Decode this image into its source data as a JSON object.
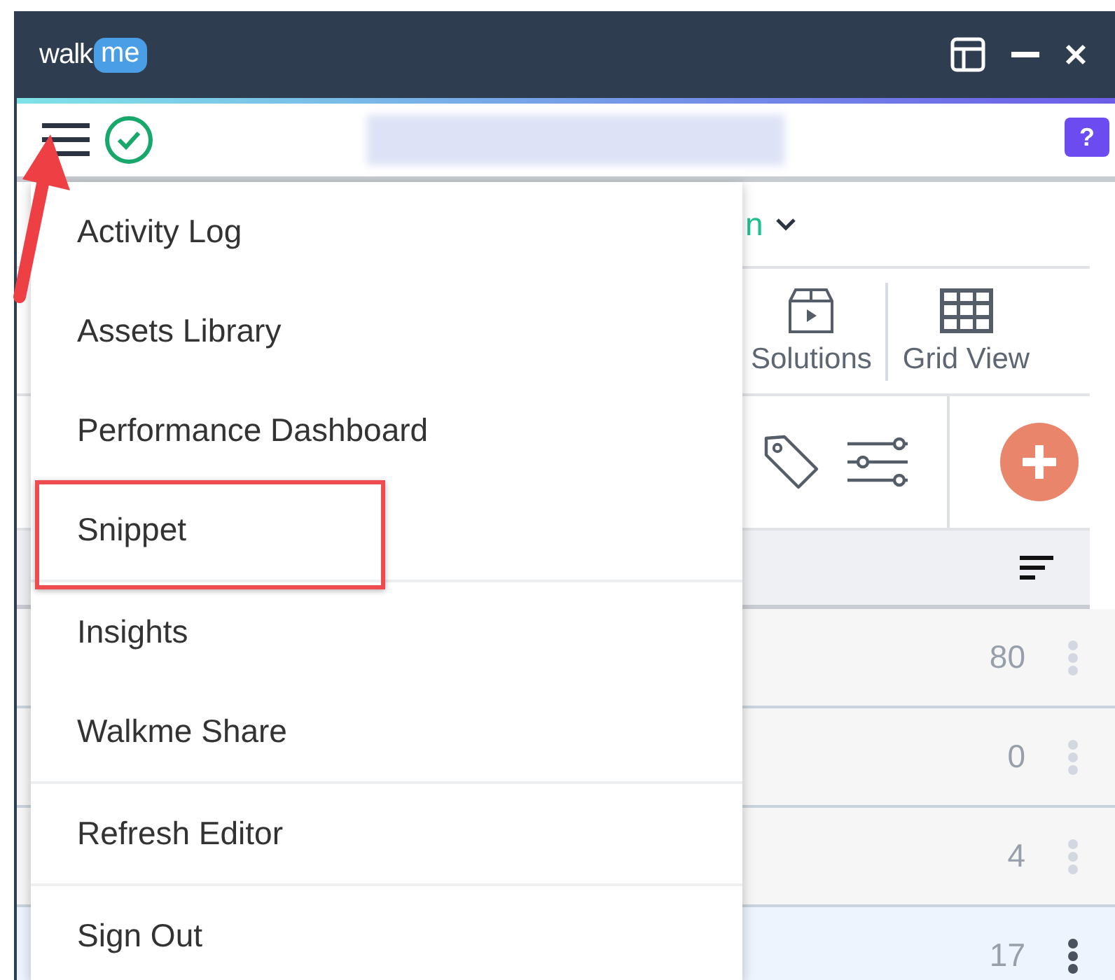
{
  "window": {
    "logo": {
      "word": "walk",
      "bubble": "me"
    }
  },
  "toolbar": {
    "help_label": "?"
  },
  "project_selector": {
    "label": "n"
  },
  "views": [
    {
      "label": "Solutions",
      "kind": "solutions"
    },
    {
      "label": "Grid View",
      "kind": "grid"
    }
  ],
  "table": {
    "rows": [
      {
        "count": "80",
        "selected": false
      },
      {
        "count": "0",
        "selected": false
      },
      {
        "count": "4",
        "selected": false
      },
      {
        "count": "17",
        "selected": true
      }
    ]
  },
  "menu": {
    "groups": [
      [
        {
          "label": "Activity Log",
          "annotated": false
        },
        {
          "label": "Assets Library",
          "annotated": false
        },
        {
          "label": "Performance Dashboard",
          "annotated": false
        },
        {
          "label": "Snippet",
          "annotated": true
        }
      ],
      [
        {
          "label": "Insights",
          "annotated": false
        },
        {
          "label": "Walkme Share",
          "annotated": false
        }
      ],
      [
        {
          "label": "Refresh Editor",
          "annotated": false
        }
      ],
      [
        {
          "label": "Sign Out",
          "annotated": false
        }
      ]
    ]
  }
}
